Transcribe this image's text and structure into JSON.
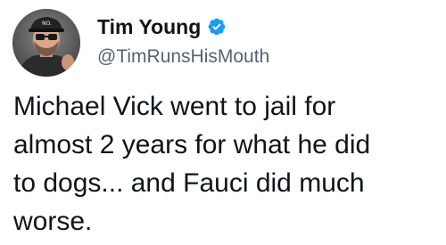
{
  "author": {
    "display_name": "Tim Young",
    "handle": "@TimRunsHisMouth",
    "verified": true,
    "avatar_icon": "avatar-photo",
    "verified_color": "#1d9bf0"
  },
  "tweet": {
    "text": "Michael Vick went to jail for\nalmost 2 years for what he did\nto dogs...  and Fauci did much\nworse."
  },
  "colors": {
    "text": "#0f1419",
    "secondary": "#536471",
    "background": "#ffffff"
  }
}
